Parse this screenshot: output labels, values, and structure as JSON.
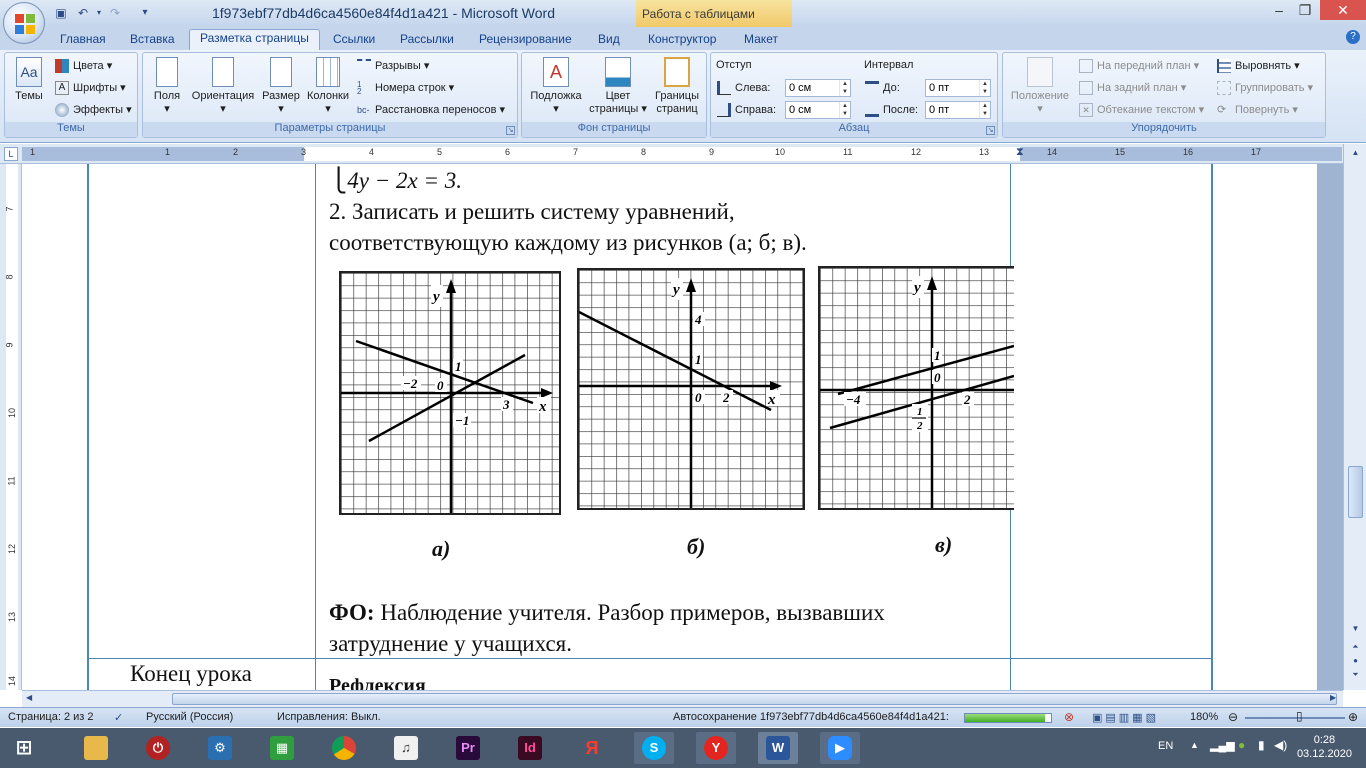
{
  "window": {
    "title": "1f973ebf77db4d6ca4560e84f4d1a421 - Microsoft Word",
    "context_tab_group": "Работа с таблицами",
    "qat": {
      "save_icon": "save-icon",
      "undo_icon": "undo-icon",
      "redo_icon": "redo-icon"
    }
  },
  "tabs": [
    "Главная",
    "Вставка",
    "Разметка страницы",
    "Ссылки",
    "Рассылки",
    "Рецензирование",
    "Вид",
    "Конструктор",
    "Макет"
  ],
  "active_tab": "Разметка страницы",
  "ribbon": {
    "themes": {
      "label": "Темы",
      "big": "Темы",
      "colors": "Цвета",
      "fonts": "Шрифты",
      "effects": "Эффекты"
    },
    "page_setup": {
      "label": "Параметры страницы",
      "margins": "Поля",
      "orientation": "Ориентация",
      "size": "Размер",
      "columns": "Колонки",
      "breaks": "Разрывы",
      "line_numbers": "Номера строк",
      "hyphenation": "Расстановка переносов"
    },
    "page_background": {
      "label": "Фон страницы",
      "watermark": "Подложка",
      "page_color_1": "Цвет",
      "page_color_2": "страницы",
      "page_borders_1": "Границы",
      "page_borders_2": "страниц"
    },
    "paragraph": {
      "label": "Абзац",
      "indent_title": "Отступ",
      "left_label": "Слева:",
      "left_value": "0 см",
      "right_label": "Справа:",
      "right_value": "0 см",
      "spacing_title": "Интервал",
      "before_label": "До:",
      "before_value": "0 пт",
      "after_label": "После:",
      "after_value": "0 пт"
    },
    "arrange": {
      "label": "Упорядочить",
      "position": "Положение",
      "bring_front": "На передний план",
      "send_back": "На задний план",
      "text_wrap": "Обтекание текстом",
      "align": "Выровнять",
      "group": "Группировать",
      "rotate": "Повернуть"
    }
  },
  "ruler": {
    "h_numbers": [
      "1",
      "1",
      "2",
      "3",
      "4",
      "5",
      "6",
      "7",
      "8",
      "9",
      "10",
      "11",
      "12",
      "13",
      "14",
      "15",
      "16",
      "17"
    ],
    "v_numbers": [
      "7",
      "8",
      "9",
      "10",
      "11",
      "12",
      "13",
      "14"
    ]
  },
  "document": {
    "eq_line": "4y − 2x = 3.",
    "task_line1": "2.  Записать и решить систему уравнений,",
    "task_line2": "соответствующую  каждому из рисунков (а; б; в).",
    "fo_bold": "ФО:",
    "fo_rest": " Наблюдение учителя. Разбор примеров, вызвавших",
    "fo_line2": "затруднение у учащихся.",
    "end_lesson": "Конец урока",
    "reflection": "Рефлексия",
    "graphs": [
      {
        "caption": "а)",
        "labels": {
          "y": "y",
          "x": "x",
          "one": "1",
          "zero": "0",
          "minus_two": "−2",
          "three": "3",
          "minus_one": "−1"
        }
      },
      {
        "caption": "б)",
        "labels": {
          "y": "y",
          "x": "x",
          "four": "4",
          "one": "1",
          "zero": "0",
          "two": "2"
        }
      },
      {
        "caption": "в)",
        "labels": {
          "y": "y",
          "one": "1",
          "zero": "0",
          "minus_four": "−4",
          "two": "2",
          "minus_half_num": "1",
          "minus_half_den": "2"
        }
      }
    ]
  },
  "status": {
    "page": "Страница: 2 из 2",
    "language": "Русский (Россия)",
    "track_changes": "Исправления: Выкл.",
    "autosave": "Автосохранение 1f973ebf77db4d6ca4560e84f4d1a421:",
    "autosave_progress": 0.93,
    "zoom": "180%"
  },
  "taskbar": {
    "lang": "EN",
    "time": "0:28",
    "date": "03.12.2020",
    "apps": [
      "start",
      "explorer",
      "power",
      "control-panel",
      "calculator",
      "chrome",
      "audio",
      "premiere",
      "indesign",
      "yandex-browser",
      "skype",
      "yandex",
      "word",
      "zoom"
    ]
  }
}
